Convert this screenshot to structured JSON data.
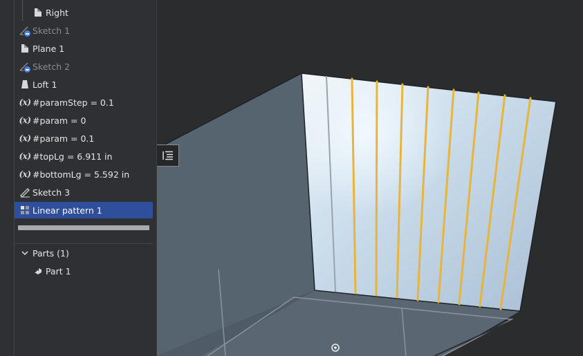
{
  "tree": {
    "items": [
      {
        "label": "Right",
        "icon": "plane-icon"
      },
      {
        "label": "Sketch 1",
        "icon": "sketch-hidden-icon"
      },
      {
        "label": "Plane 1",
        "icon": "plane-icon"
      },
      {
        "label": "Sketch 2",
        "icon": "sketch-hidden-icon"
      },
      {
        "label": "Loft 1",
        "icon": "loft-icon"
      },
      {
        "label": "#paramStep = 0.1",
        "icon": "variable-icon"
      },
      {
        "label": "#param = 0",
        "icon": "variable-icon"
      },
      {
        "label": "#param = 0.1",
        "icon": "variable-icon"
      },
      {
        "label": "#topLg = 6.911 in",
        "icon": "variable-icon"
      },
      {
        "label": "#bottomLg = 5.592 in",
        "icon": "variable-icon"
      },
      {
        "label": "Sketch 3",
        "icon": "sketch-icon"
      },
      {
        "label": "Linear pattern 1",
        "icon": "linear-pattern-icon",
        "selected": true
      }
    ],
    "variable_glyph": "(x)"
  },
  "parts": {
    "header": "Parts (1)",
    "items": [
      {
        "label": "Part 1",
        "icon": "part-icon"
      }
    ]
  },
  "colors": {
    "selection": "#2f4e9c",
    "pattern_lines": "#e8b43a",
    "face": "#b8cde0",
    "side": "#56636f"
  }
}
